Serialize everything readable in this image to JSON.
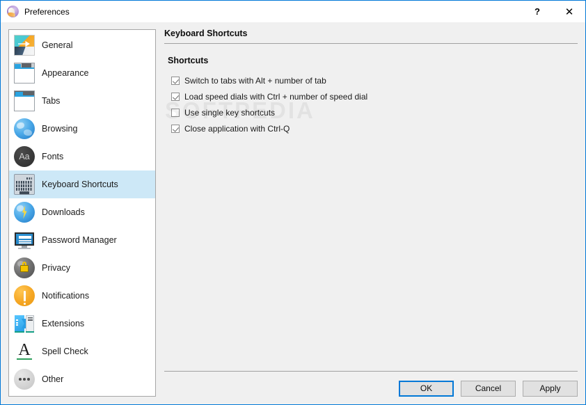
{
  "window": {
    "title": "Preferences",
    "logo_icon": "otter-browser-logo",
    "help_label": "?",
    "close_label": "✕",
    "accent_color": "#0078d7",
    "frame_background": "#f0f0f0",
    "titlebar_background": "#ffffff"
  },
  "sidebar": {
    "selected_index": 5,
    "selection_color": "#cde8f7",
    "items": [
      {
        "label": "General",
        "icon": "picture-general-icon"
      },
      {
        "label": "Appearance",
        "icon": "window-appearance-icon"
      },
      {
        "label": "Tabs",
        "icon": "window-tabs-icon"
      },
      {
        "label": "Browsing",
        "icon": "globe-browsing-icon"
      },
      {
        "label": "Fonts",
        "icon": "fonts-aa-icon"
      },
      {
        "label": "Keyboard Shortcuts",
        "icon": "keyboard-icon"
      },
      {
        "label": "Downloads",
        "icon": "globe-download-icon"
      },
      {
        "label": "Password Manager",
        "icon": "monitor-password-icon"
      },
      {
        "label": "Privacy",
        "icon": "globe-lock-privacy-icon"
      },
      {
        "label": "Notifications",
        "icon": "exclamation-circle-icon"
      },
      {
        "label": "Extensions",
        "icon": "puzzle-extensions-icon"
      },
      {
        "label": "Spell Check",
        "icon": "letter-a-underline-icon"
      },
      {
        "label": "Other",
        "icon": "ellipsis-circle-icon"
      }
    ]
  },
  "main": {
    "panel_title": "Keyboard Shortcuts",
    "group_title": "Shortcuts",
    "checkboxes": [
      {
        "label": "Switch to tabs with Alt + number of tab",
        "checked": true
      },
      {
        "label": "Load speed dials with Ctrl + number of speed dial",
        "checked": true
      },
      {
        "label": "Use single key shortcuts",
        "checked": false
      },
      {
        "label": "Close application with Ctrl-Q",
        "checked": true
      }
    ]
  },
  "buttons": {
    "ok": "OK",
    "cancel": "Cancel",
    "apply": "Apply",
    "default_button": "ok"
  },
  "watermark": {
    "text": "SOFTPEDIA"
  }
}
